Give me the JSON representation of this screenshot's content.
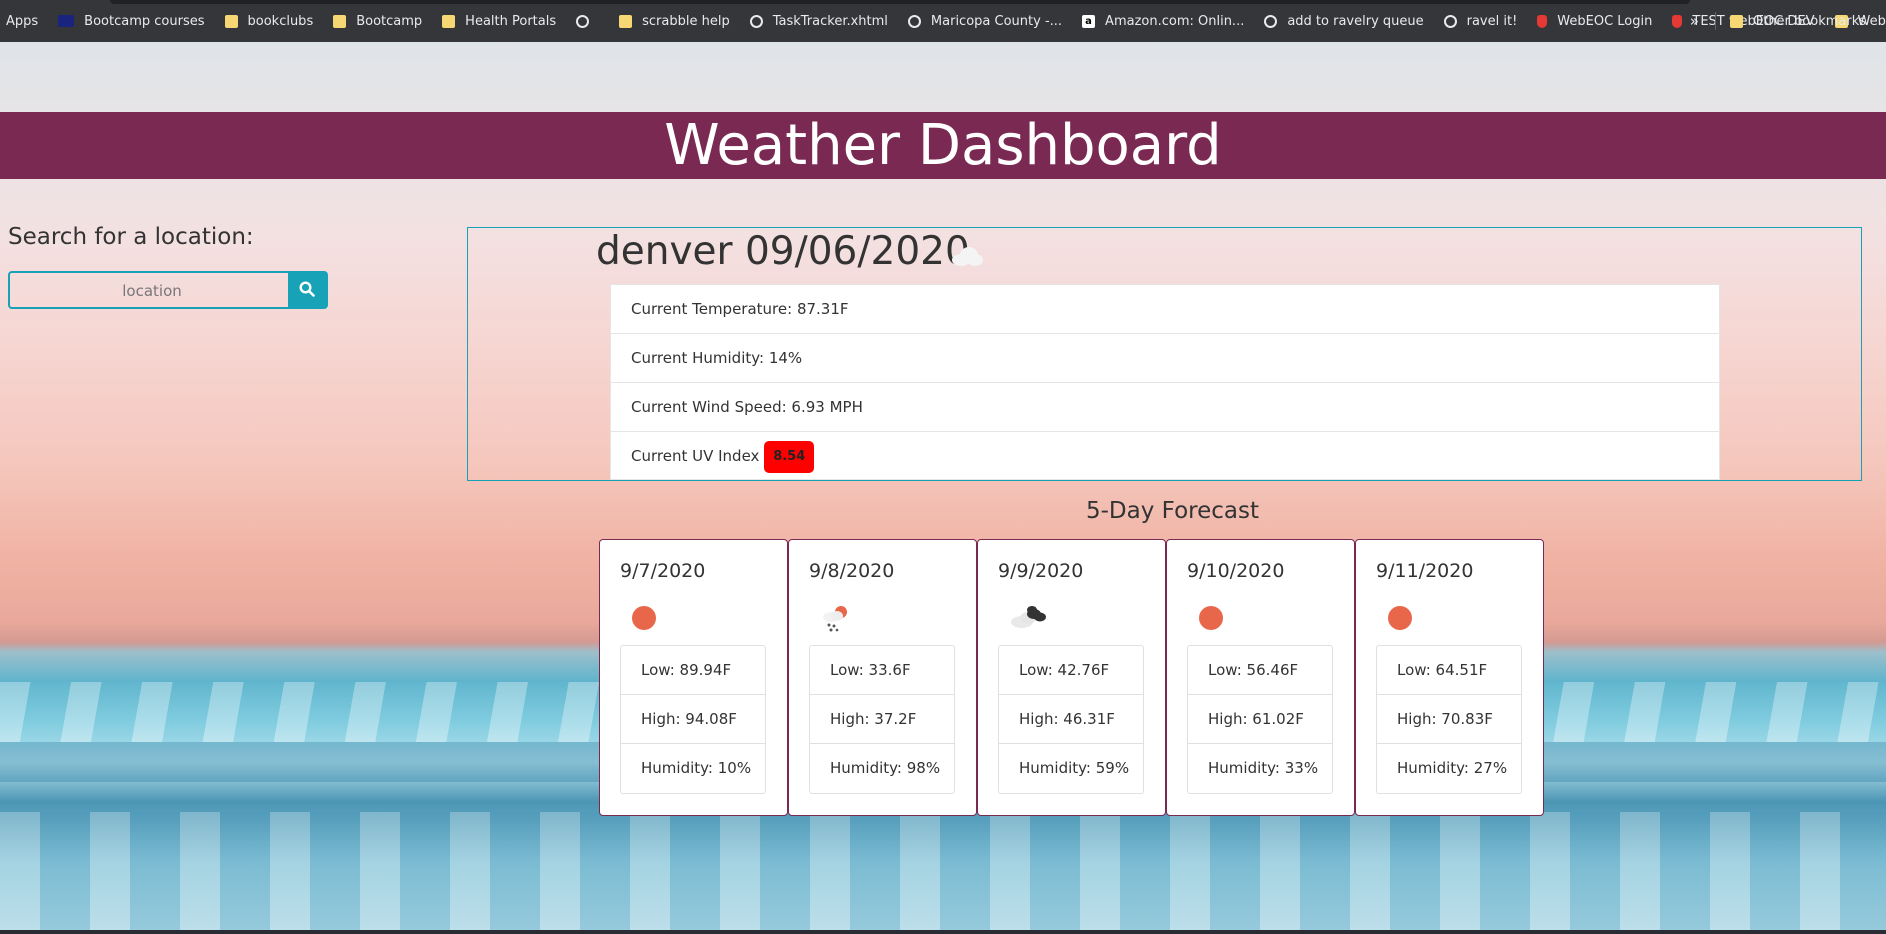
{
  "bookmarks": {
    "apps_label": "Apps",
    "items": [
      {
        "label": "Bootcamp courses",
        "icon": "bootcamp-logo-icon"
      },
      {
        "label": "bookclubs",
        "icon": "folder-icon"
      },
      {
        "label": "Bootcamp",
        "icon": "folder-icon"
      },
      {
        "label": "Health Portals",
        "icon": "folder-icon"
      },
      {
        "label": "",
        "icon": "globe-icon"
      },
      {
        "label": "scrabble help",
        "icon": "folder-icon"
      },
      {
        "label": "TaskTracker.xhtml",
        "icon": "globe-icon"
      },
      {
        "label": "Maricopa County -...",
        "icon": "globe-icon"
      },
      {
        "label": "Amazon.com: Onlin...",
        "icon": "amazon-icon"
      },
      {
        "label": "add to ravelry queue",
        "icon": "globe-icon"
      },
      {
        "label": "ravel it!",
        "icon": "globe-icon"
      },
      {
        "label": "WebEOC Login",
        "icon": "webeoc-icon"
      },
      {
        "label": "TEST webEOC DEV",
        "icon": "webeoc-icon"
      },
      {
        "label": "WebEOC",
        "icon": "folder-icon"
      }
    ],
    "overflow": "»",
    "other_label": "Other bookmarks"
  },
  "header": {
    "title": "Weather Dashboard"
  },
  "search": {
    "label": "Search for a location:",
    "placeholder": "location"
  },
  "current": {
    "city_date": "denver 09/06/2020",
    "icon": "cloud-icon",
    "temperature": "Current Temperature: 87.31F",
    "humidity": "Current Humidity: 14%",
    "wind": "Current Wind Speed: 6.93 MPH",
    "uv_label": "Current UV Index",
    "uv_value": "8.54",
    "uv_color": "#ff0000"
  },
  "forecast": {
    "title": "5-Day Forecast",
    "days": [
      {
        "date": "9/7/2020",
        "icon": "sun-icon",
        "low": "Low: 89.94F",
        "high": "High: 94.08F",
        "humidity": "Humidity: 10%"
      },
      {
        "date": "9/8/2020",
        "icon": "snow-sun-icon",
        "low": "Low: 33.6F",
        "high": "High: 37.2F",
        "humidity": "Humidity: 98%"
      },
      {
        "date": "9/9/2020",
        "icon": "cloudy-icon",
        "low": "Low: 42.76F",
        "high": "High: 46.31F",
        "humidity": "Humidity: 59%"
      },
      {
        "date": "9/10/2020",
        "icon": "sun-icon",
        "low": "Low: 56.46F",
        "high": "High: 61.02F",
        "humidity": "Humidity: 33%"
      },
      {
        "date": "9/11/2020",
        "icon": "sun-icon",
        "low": "Low: 64.51F",
        "high": "High: 70.83F",
        "humidity": "Humidity: 27%"
      }
    ]
  },
  "colors": {
    "header_bg": "#7a2952",
    "accent": "#17a2b8",
    "sun": "#e8674a"
  }
}
